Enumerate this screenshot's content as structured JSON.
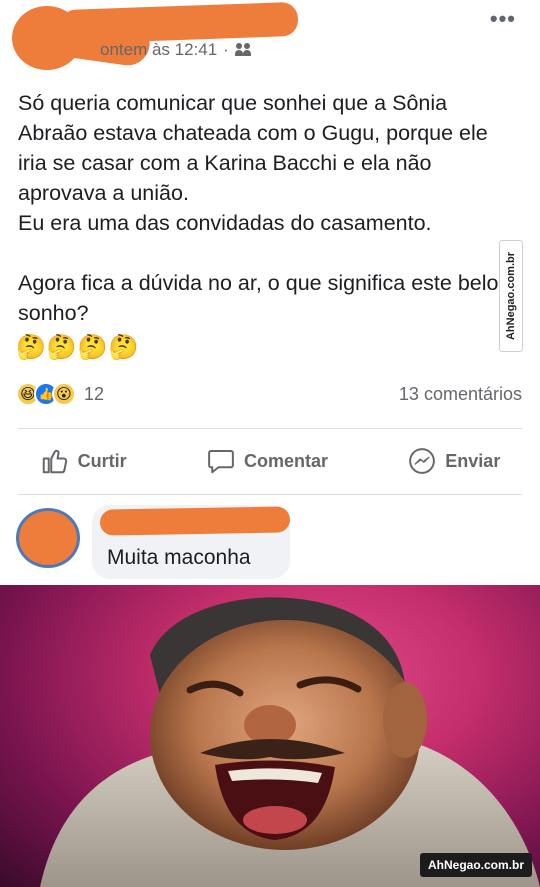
{
  "post": {
    "timestamp": "ontem às 12:41",
    "privacy_separator": "·",
    "privacy_icon": "friends-icon",
    "more_label": "•••",
    "paragraphs": [
      "Só queria comunicar que sonhei que a Sônia Abraão estava chateada com o Gugu, porque ele iria se casar com a Karina Bacchi e ela não aprovava a união.\nEu era uma das convidadas do casamento.",
      "Agora fica a dúvida no ar, o que significa este belo sonho?"
    ],
    "emojis": "🤔🤔🤔🤔"
  },
  "reactions": {
    "icons": [
      "haha-reaction-icon",
      "like-reaction-icon",
      "wow-reaction-icon"
    ],
    "haha": "😆",
    "like": "👍",
    "wow": "😮",
    "count": "12",
    "comments_label": "13 comentários"
  },
  "actions": {
    "like": "Curtir",
    "comment": "Comentar",
    "share": "Enviar"
  },
  "comment": {
    "text": "Muita maconha"
  },
  "watermarks": {
    "vertical": "AhNegao.com.br",
    "badge": "AhNegao.com.br"
  },
  "colors": {
    "redaction": "#ee7d3b",
    "text_primary": "#1c1e21",
    "text_secondary": "#65676b",
    "comment_bubble": "#f0f2f5",
    "meme_background": "#c22d6a"
  }
}
